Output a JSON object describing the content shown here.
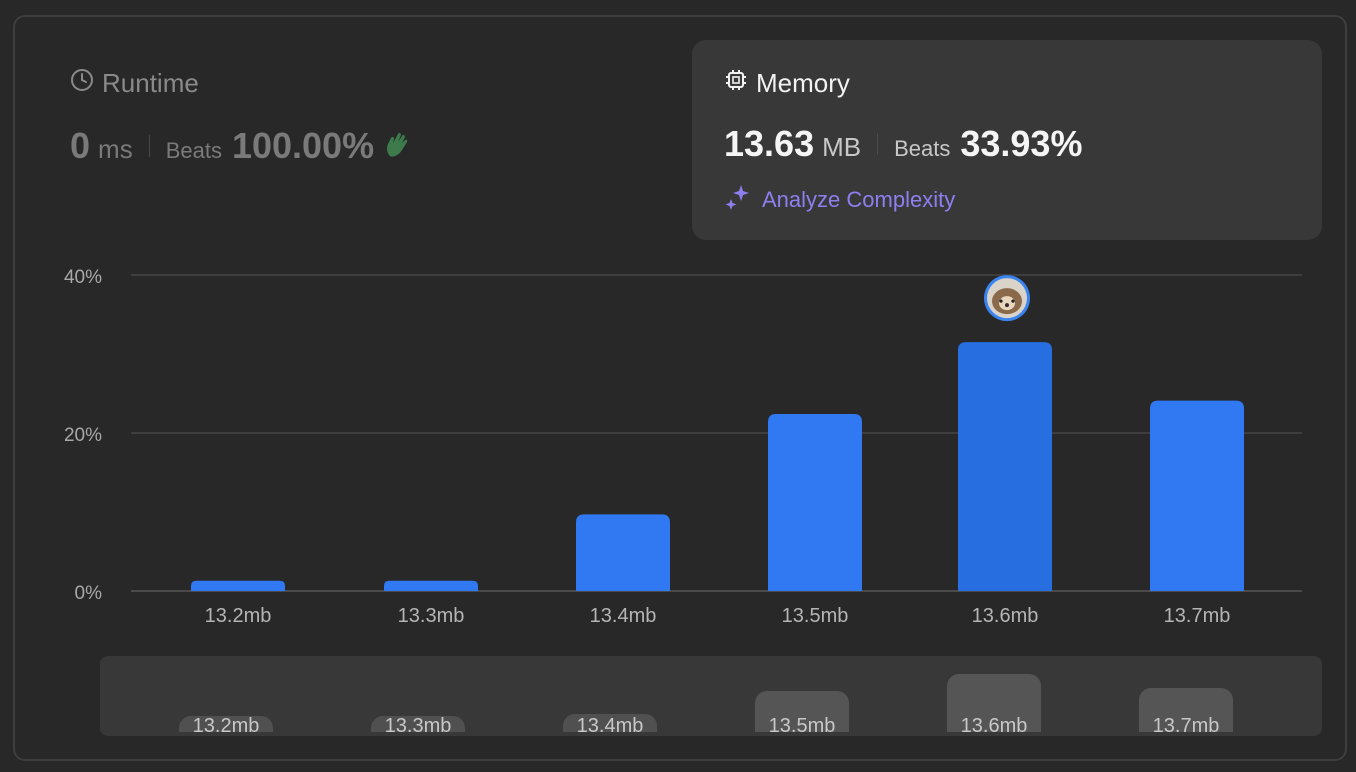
{
  "runtime": {
    "title": "Runtime",
    "value": "0",
    "unit": "ms",
    "beats_label": "Beats",
    "beats_value": "100.00%"
  },
  "memory": {
    "title": "Memory",
    "value": "13.63",
    "unit": "MB",
    "beats_label": "Beats",
    "beats_value": "33.93%",
    "analyze_label": "Analyze Complexity"
  },
  "colors": {
    "bar": "#3079f3",
    "bar_selected": "#276fe0",
    "accent_purple": "#8d7ff0"
  },
  "chart_data": {
    "type": "bar",
    "categories": [
      "13.2mb",
      "13.3mb",
      "13.4mb",
      "13.5mb",
      "13.6mb",
      "13.7mb"
    ],
    "values": [
      1.3,
      1.3,
      9.7,
      22.4,
      31.5,
      24.1
    ],
    "y_ticks": [
      "0%",
      "20%",
      "40%"
    ],
    "ylim": [
      0,
      40
    ],
    "grid": true,
    "selected_category": "13.6mb",
    "xlabel": "",
    "ylabel": "",
    "title": ""
  },
  "overview": {
    "labels": [
      "13.2mb",
      "13.3mb",
      "13.4mb",
      "13.5mb",
      "13.6mb",
      "13.7mb"
    ]
  },
  "icons": {
    "runtime": "clock-icon",
    "memory": "cpu-chip-icon",
    "clap": "clapping-hands-icon",
    "analyze": "sparkle-icon",
    "avatar": "hedgehog-avatar"
  }
}
